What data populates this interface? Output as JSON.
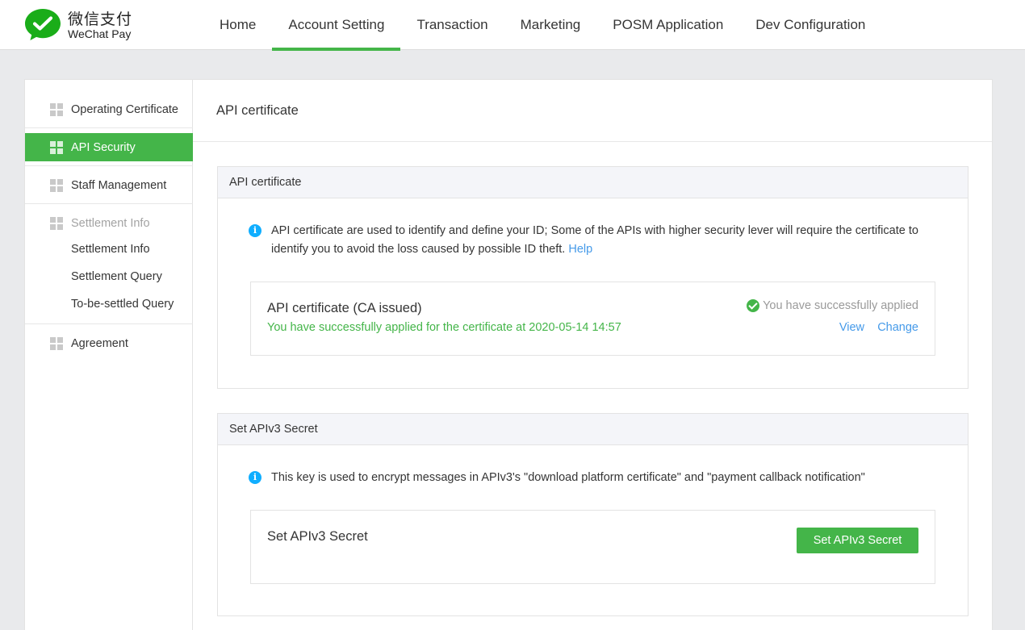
{
  "header": {
    "logo_cn": "微信支付",
    "logo_en": "WeChat Pay",
    "nav": [
      {
        "label": "Home"
      },
      {
        "label": "Account Setting"
      },
      {
        "label": "Transaction"
      },
      {
        "label": "Marketing"
      },
      {
        "label": "POSM Application"
      },
      {
        "label": "Dev Configuration"
      }
    ],
    "active_nav": "Account Setting"
  },
  "sidebar": {
    "items": [
      {
        "label": "Operating Certificate",
        "active": false
      },
      {
        "label": "API Security",
        "active": true
      },
      {
        "label": "Staff Management",
        "active": false
      },
      {
        "label": "Settlement Info",
        "group": true
      },
      {
        "label": "Agreement",
        "active": false
      }
    ],
    "settlement_sub": [
      {
        "label": "Settlement Info"
      },
      {
        "label": "Settlement Query"
      },
      {
        "label": "To-be-settled Query"
      }
    ]
  },
  "main": {
    "title": "API certificate",
    "cert_section": {
      "header": "API certificate",
      "info_text": "API certificate are used to identify and define your ID; Some of the APIs with higher security lever will require the certificate to identify you to avoid the loss caused by possible ID theft.",
      "help_link": "Help",
      "box_title": "API certificate (CA issued)",
      "box_sub": "You have successfully applied for the certificate at 2020-05-14 14:57",
      "status": "You have successfully applied",
      "view_link": "View",
      "change_link": "Change"
    },
    "apiv3_section": {
      "header": "Set APIv3 Secret",
      "info_text": "This key is used to encrypt messages in APIv3's \"download platform certificate\" and \"payment callback notification\"",
      "box_title": "Set APIv3 Secret",
      "button_label": "Set APIv3 Secret"
    }
  },
  "colors": {
    "accent": "#44b549",
    "link": "#459ae9",
    "info": "#10aeff"
  }
}
